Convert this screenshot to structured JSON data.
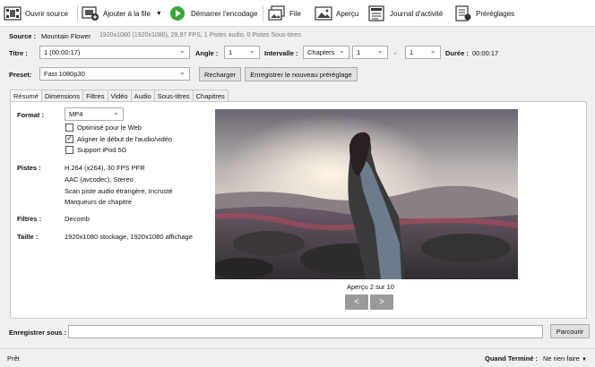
{
  "toolbar": {
    "open_source": "Ouvrir source",
    "add_to_queue": "Ajouter à la file",
    "start_encode": "Démarrer l'encodage",
    "queue": "File",
    "preview": "Aperçu",
    "activity_log": "Journal d'activité",
    "presets": "Préréglages"
  },
  "source": {
    "label": "Source :",
    "name": "Mountain Flower",
    "details": "1920x1080 (1920x1080), 29,97 FPS, 1 Pistes audio, 0 Pistes Sous-titres"
  },
  "title_row": {
    "title_label": "Titre :",
    "title_value": "1 (00:00:17)",
    "angle_label": "Angle :",
    "angle_value": "1",
    "interval_label": "Intervalle :",
    "interval_mode": "Chapters",
    "interval_start": "1",
    "interval_dash": "-",
    "interval_end": "1",
    "duration_label": "Durée :",
    "duration_value": "00:00:17"
  },
  "preset": {
    "label": "Preset:",
    "value": "Fast 1080p30",
    "reload_label": "Recharger",
    "save_label": "Enregistrer le nouveau préréglage"
  },
  "tabs": [
    "Résumé",
    "Dimensions",
    "Filtres",
    "Vidéo",
    "Audio",
    "Sous-titres",
    "Chapitres"
  ],
  "summary": {
    "format_label": "Format :",
    "format_value": "MP4",
    "opt_web": "Optimisé pour le Web",
    "opt_web_checked": false,
    "opt_align": "Aligner le début de l'audio/vidéo",
    "opt_align_checked": true,
    "opt_ipod": "Support iPod 5G",
    "opt_ipod_checked": false,
    "tracks_label": "Pistes :",
    "tracks": [
      "H.264 (x264), 30 FPS PFR",
      "AAC (avcodec), Stereo",
      "Scan piste audio étrangère, Incrusté",
      "Marqueurs de chapitre"
    ],
    "filters_label": "Filtres :",
    "filters_value": "Decomb",
    "size_label": "Taille :",
    "size_value": "1920x1080 stockage, 1920x1080 affichage"
  },
  "preview": {
    "caption": "Aperçu 2 sur 10",
    "prev": "<",
    "next": ">"
  },
  "save": {
    "label": "Enregistrer sous :",
    "value": "",
    "browse": "Parcourir"
  },
  "status": {
    "text": "Prêt",
    "when_done_label": "Quand Terminé :",
    "when_done_value": "Ne rien faire"
  },
  "colors": {
    "start_green": "#3aa63a",
    "nav_button": "#9a9a9a"
  }
}
